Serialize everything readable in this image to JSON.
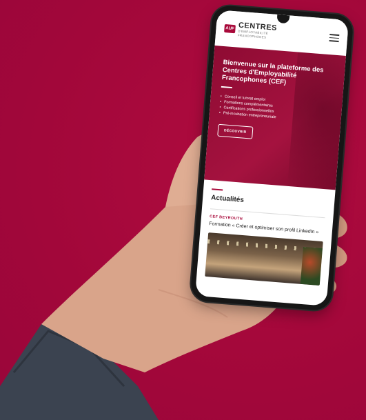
{
  "header": {
    "logo_mark": "AUF",
    "logo_main": "CENTRES",
    "logo_sub1": "D'EMPLOYABILITÉ",
    "logo_sub2": "FRANCOPHONES"
  },
  "hero": {
    "title": "Bienvenue sur la plateforme des Centres d'Employabilité Francophones (CEF)",
    "list": [
      "Conseil et tutorat emploi",
      "Formations complémentaires",
      "Certifications professionnelles",
      "Pré-incubation entrepreneuriale"
    ],
    "button": "DÉCOUVRIR"
  },
  "news": {
    "title": "Actualités",
    "category": "CEF BEYROUTH",
    "headline": "Formation « Créer et optimiser son profil LinkedIn »"
  },
  "colors": {
    "background": "#a8093a",
    "accent": "#a8093a"
  }
}
